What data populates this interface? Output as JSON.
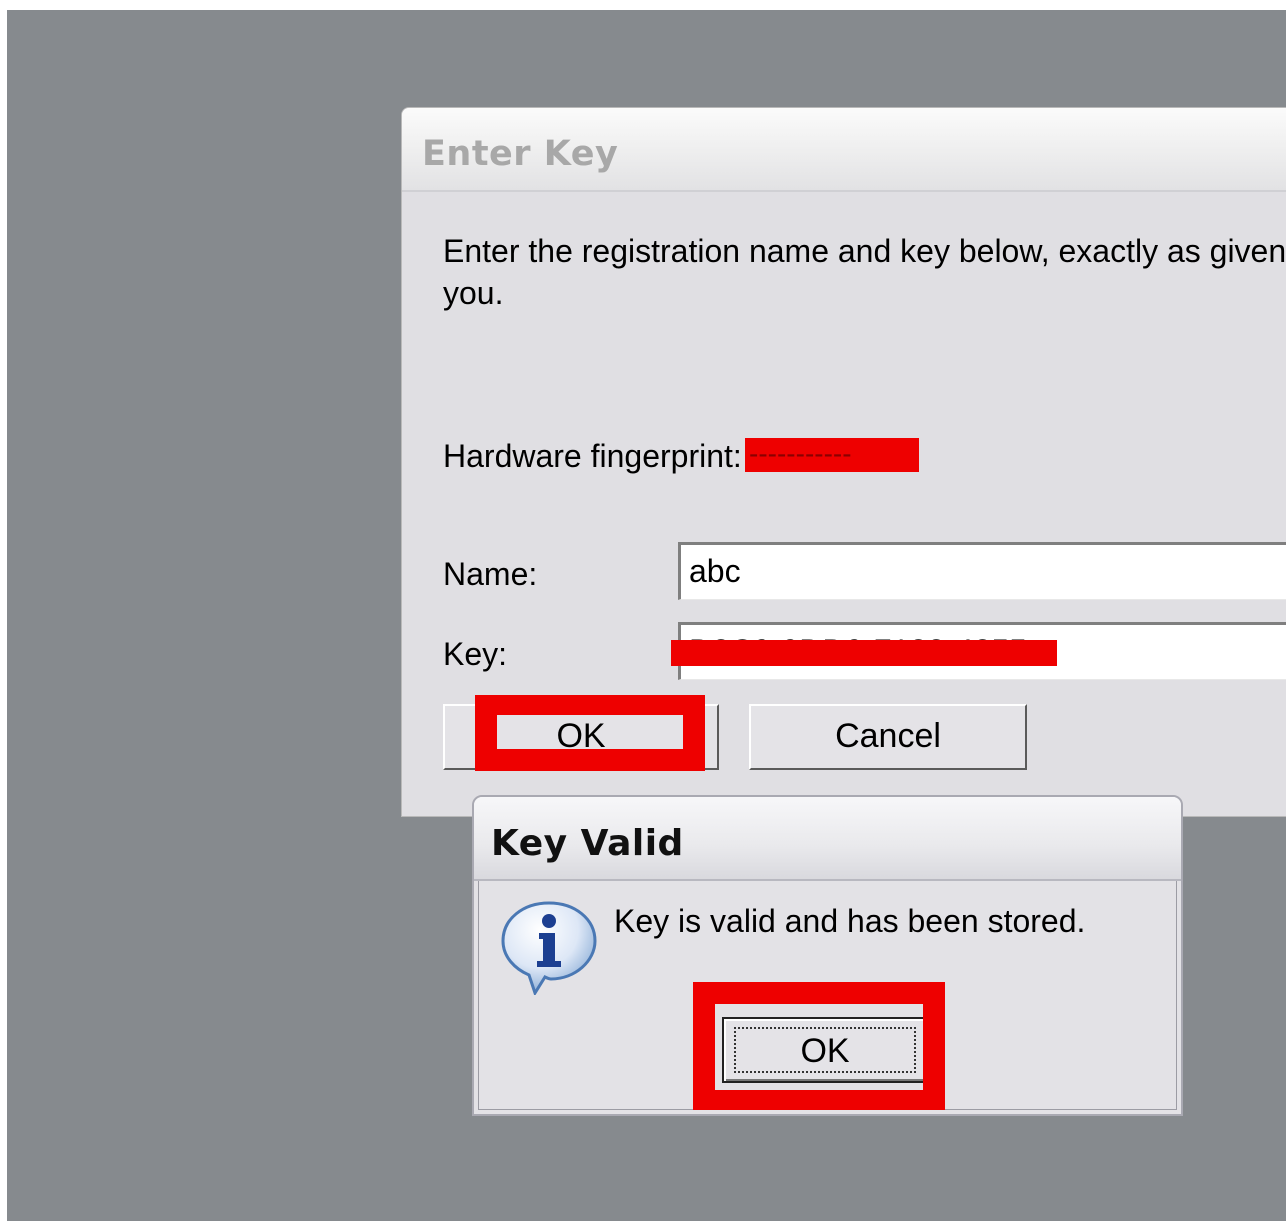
{
  "enter_key_dialog": {
    "title": "Enter Key",
    "description": "Enter the registration name and key below, exactly as given\nyou.",
    "hardware_label": "Hardware fingerprint:",
    "hardware_value_redacted": "-----------",
    "name_label": "Name:",
    "name_value": "abc",
    "key_label": "Key:",
    "key_value_redacted": "D3C9-9DD9-7133-4355",
    "ok_label": "OK",
    "cancel_label": "Cancel"
  },
  "key_valid_dialog": {
    "title": "Key Valid",
    "message": "Key is valid and has been stored.",
    "icon": "info-icon",
    "ok_label": "OK"
  },
  "colors": {
    "desktop": "#868a8e",
    "dialog_face": "#e0dfe3",
    "highlight_red": "#ee0000"
  }
}
